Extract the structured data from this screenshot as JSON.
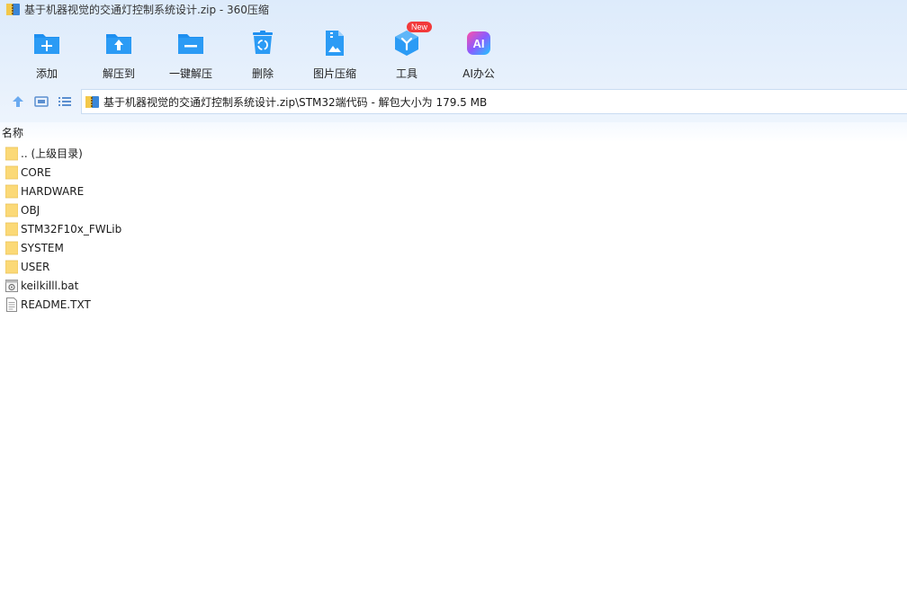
{
  "window": {
    "title": "基于机器视觉的交通灯控制系统设计.zip - 360压缩"
  },
  "toolbar": {
    "add_label": "添加",
    "extract_to_label": "解压到",
    "one_click_extract_label": "一键解压",
    "delete_label": "删除",
    "image_compress_label": "图片压缩",
    "tools_label": "工具",
    "tools_badge": "New",
    "ai_office_label": "AI办公",
    "ai_icon_text": "AI"
  },
  "nav": {
    "path": "基于机器视觉的交通灯控制系统设计.zip\\STM32端代码 - 解包大小为 179.5 MB"
  },
  "file_list": {
    "column_name": "名称",
    "items": [
      {
        "name": ".. (上级目录)",
        "type": "folder"
      },
      {
        "name": "CORE",
        "type": "folder"
      },
      {
        "name": "HARDWARE",
        "type": "folder"
      },
      {
        "name": "OBJ",
        "type": "folder"
      },
      {
        "name": "STM32F10x_FWLib",
        "type": "folder"
      },
      {
        "name": "SYSTEM",
        "type": "folder"
      },
      {
        "name": "USER",
        "type": "folder"
      },
      {
        "name": "keilkilll.bat",
        "type": "bat"
      },
      {
        "name": "README.TXT",
        "type": "txt"
      }
    ]
  },
  "colors": {
    "accent": "#1e8ff0",
    "folder": "#fbd977",
    "badge": "#f23a3a"
  }
}
